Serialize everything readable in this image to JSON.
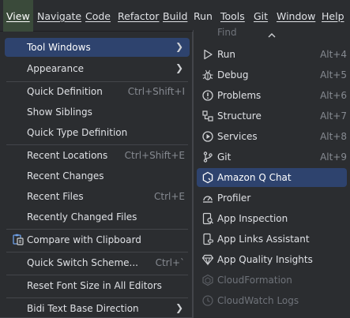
{
  "menubar": {
    "items": [
      {
        "label": "View",
        "mnemonic": "V"
      },
      {
        "label": "Navigate",
        "mnemonic": "N"
      },
      {
        "label": "Code",
        "mnemonic": "C"
      },
      {
        "label": "Refactor",
        "mnemonic": "R"
      },
      {
        "label": "Build",
        "mnemonic": "B"
      },
      {
        "label": "Run",
        "mnemonic": "u"
      },
      {
        "label": "Tools",
        "mnemonic": "T"
      },
      {
        "label": "Git",
        "mnemonic": "G"
      },
      {
        "label": "Window",
        "mnemonic": "W"
      },
      {
        "label": "Help",
        "mnemonic": "H"
      }
    ]
  },
  "view_menu": {
    "items": [
      {
        "label": "Tool Windows",
        "shortcut": "",
        "submenu": true,
        "selected": true
      },
      {
        "label": "Appearance",
        "shortcut": "",
        "submenu": true
      },
      {
        "label": "Quick Definition",
        "shortcut": "Ctrl+Shift+I"
      },
      {
        "label": "Show Siblings",
        "shortcut": ""
      },
      {
        "label": "Quick Type Definition",
        "shortcut": ""
      },
      {
        "label": "Recent Locations",
        "shortcut": "Ctrl+Shift+E"
      },
      {
        "label": "Recent Changes",
        "shortcut": ""
      },
      {
        "label": "Recent Files",
        "shortcut": "Ctrl+E"
      },
      {
        "label": "Recently Changed Files",
        "shortcut": ""
      },
      {
        "label": "Compare with Clipboard",
        "shortcut": "",
        "icon": "clipboard-compare-icon"
      },
      {
        "label": "Quick Switch Scheme...",
        "shortcut": "Ctrl+`"
      },
      {
        "label": "Reset Font Size in All Editors",
        "shortcut": ""
      },
      {
        "label": "Bidi Text Base Direction",
        "shortcut": "",
        "submenu": true
      }
    ]
  },
  "tool_windows_menu": {
    "cut_off_label": "Find",
    "items": [
      {
        "label": "Run",
        "shortcut": "Alt+4",
        "icon": "run-icon"
      },
      {
        "label": "Debug",
        "shortcut": "Alt+5",
        "icon": "debug-icon"
      },
      {
        "label": "Problems",
        "shortcut": "Alt+6",
        "icon": "problems-icon"
      },
      {
        "label": "Structure",
        "shortcut": "Alt+7",
        "icon": "structure-icon"
      },
      {
        "label": "Services",
        "shortcut": "Alt+8",
        "icon": "services-icon"
      },
      {
        "label": "Git",
        "shortcut": "Alt+9",
        "icon": "git-icon"
      },
      {
        "label": "Amazon Q Chat",
        "shortcut": "",
        "icon": "amazon-q-icon",
        "selected": true
      },
      {
        "label": "Profiler",
        "shortcut": "",
        "icon": "profiler-icon"
      },
      {
        "label": "App Inspection",
        "shortcut": "",
        "icon": "app-inspection-icon"
      },
      {
        "label": "App Links Assistant",
        "shortcut": "",
        "icon": "app-links-icon"
      },
      {
        "label": "App Quality Insights",
        "shortcut": "",
        "icon": "app-quality-icon"
      },
      {
        "label": "CloudFormation",
        "shortcut": "",
        "icon": "cloudformation-icon",
        "disabled": true
      },
      {
        "label": "CloudWatch Logs",
        "shortcut": "",
        "icon": "cloudwatch-icon",
        "disabled": true
      }
    ]
  },
  "colors": {
    "background": "#2b2d30",
    "selection": "#2e436e",
    "shortcut_text": "#868a91",
    "disabled_text": "#6f737a"
  }
}
